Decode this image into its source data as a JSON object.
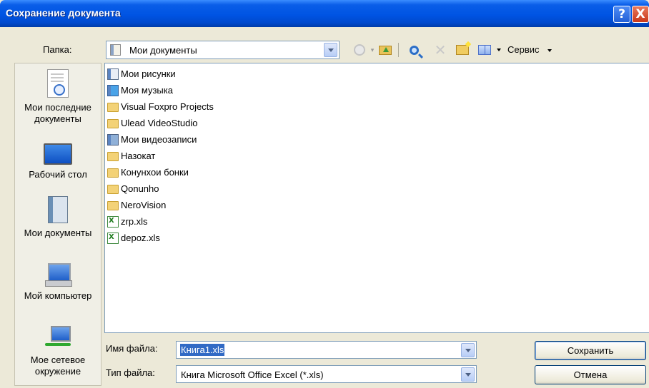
{
  "window": {
    "title": "Сохранение документа"
  },
  "titlebar_buttons": {
    "help": "?",
    "close": "X"
  },
  "folder": {
    "label": "Папка:",
    "value": "Мои документы"
  },
  "toolbar": {
    "service_label": "Сервис"
  },
  "places": [
    {
      "label": "Мои последние документы",
      "icon": "recent-documents-icon"
    },
    {
      "label": "Рабочий стол",
      "icon": "desktop-icon"
    },
    {
      "label": "Мои документы",
      "icon": "my-documents-icon"
    },
    {
      "label": "Мой компьютер",
      "icon": "my-computer-icon"
    },
    {
      "label": "Мое сетевое окружение",
      "icon": "network-places-icon"
    }
  ],
  "files": [
    {
      "name": "Мои рисунки",
      "icon": "pictures"
    },
    {
      "name": "Моя музыка",
      "icon": "music"
    },
    {
      "name": "Visual Foxpro Projects",
      "icon": "folder"
    },
    {
      "name": "Ulead VideoStudio",
      "icon": "folder"
    },
    {
      "name": "Мои видеозаписи",
      "icon": "videos"
    },
    {
      "name": "Назокат",
      "icon": "folder"
    },
    {
      "name": "Конунхои бонки",
      "icon": "folder"
    },
    {
      "name": "Qonunho",
      "icon": "folder"
    },
    {
      "name": "NeroVision",
      "icon": "folder"
    },
    {
      "name": "zrp.xls",
      "icon": "xls"
    },
    {
      "name": "depoz.xls",
      "icon": "xls"
    }
  ],
  "filename": {
    "label": "Имя файла:",
    "value": "Книга1.xls"
  },
  "filetype": {
    "label": "Тип файла:",
    "value": "Книга Microsoft Office Excel (*.xls)"
  },
  "buttons": {
    "save": "Сохранить",
    "cancel": "Отмена"
  }
}
